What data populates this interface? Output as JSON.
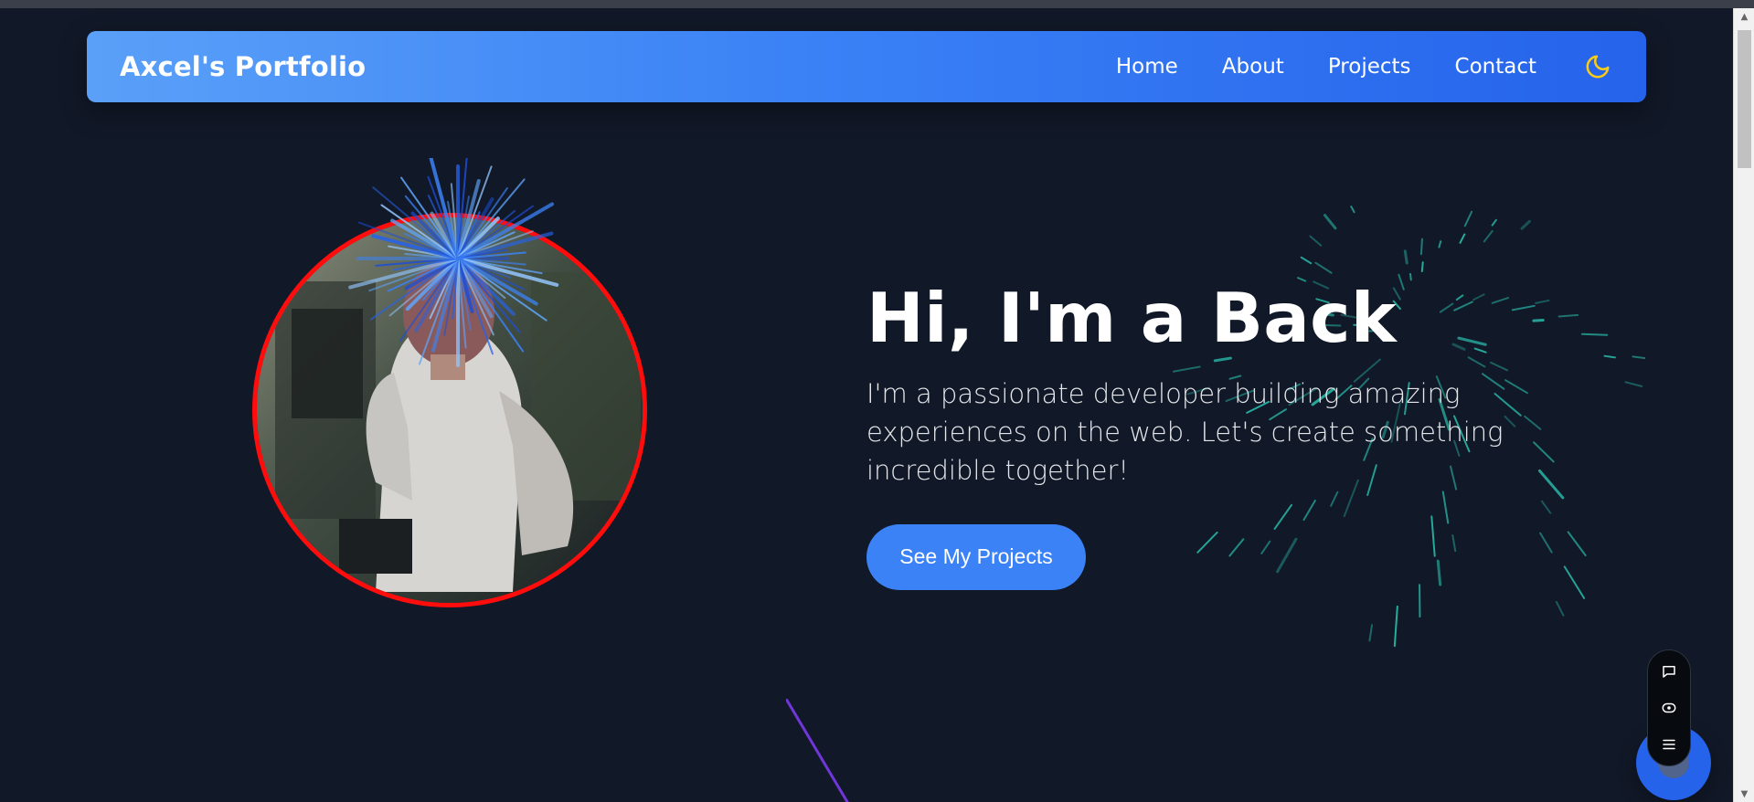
{
  "navbar": {
    "brand": "Axcel's Portfolio",
    "links": [
      "Home",
      "About",
      "Projects",
      "Contact"
    ],
    "theme_icon": "moon-icon",
    "colors": {
      "gradient_start": "#5aa0f8",
      "gradient_mid": "#3b82f6",
      "gradient_end": "#2563eb"
    }
  },
  "hero": {
    "title": "Hi, I'm a Back",
    "subtitle": "I'm a passionate developer building amazing experiences on the web. Let's create something incredible together!",
    "cta_label": "See My Projects",
    "avatar_border_color": "#ff0c0c"
  },
  "floating_controls": {
    "icons": [
      "chat-icon",
      "eye-icon",
      "menu-icon"
    ]
  },
  "theme": {
    "background": "#111827",
    "accent": "#3b82f6",
    "spark_color": "#2dd4bf",
    "burst_color": "#3b82f6",
    "streak_color": "#7c3aed"
  }
}
